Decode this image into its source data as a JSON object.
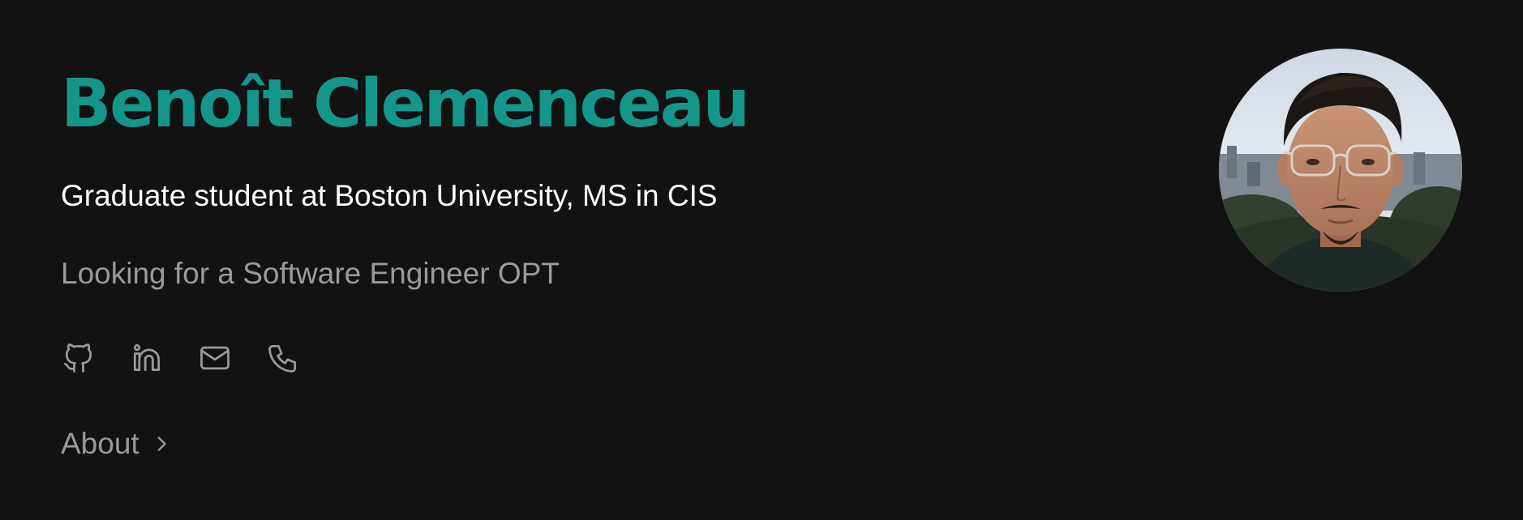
{
  "profile": {
    "name": "Benoît Clemenceau",
    "subtitle": "Graduate student at Boston University, MS in CIS",
    "status": "Looking for a Software Engineer OPT"
  },
  "socials": [
    {
      "icon": "github-icon"
    },
    {
      "icon": "linkedin-icon"
    },
    {
      "icon": "mail-icon"
    },
    {
      "icon": "phone-icon"
    }
  ],
  "nav": {
    "about_label": "About",
    "about_icon": "chevron-right-icon"
  },
  "colors": {
    "background": "#121212",
    "accent": "#14968a",
    "text_primary": "#ffffff",
    "text_muted": "#9a9a9a"
  }
}
